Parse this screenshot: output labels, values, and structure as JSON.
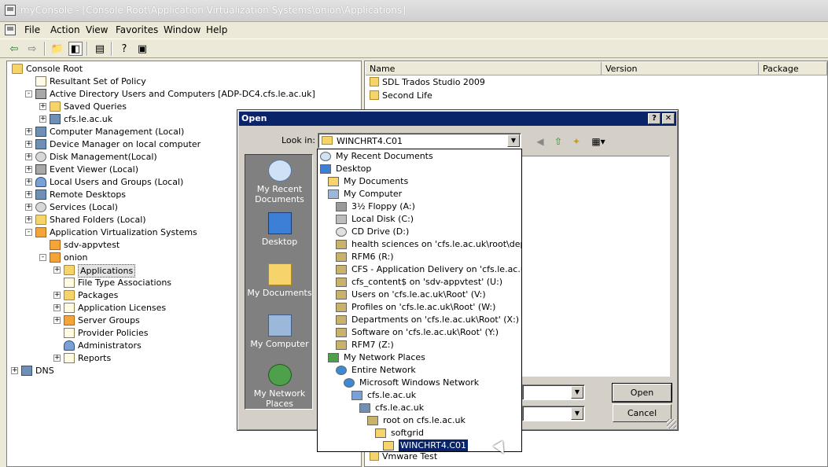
{
  "window": {
    "title": "myConsole - [Console Root\\Application Virtualization Systems\\onion\\Applications]"
  },
  "menu": [
    "File",
    "Action",
    "View",
    "Favorites",
    "Window",
    "Help"
  ],
  "tree": [
    {
      "label": "Console Root",
      "icon": "folder-icon",
      "level": 0,
      "expander": ""
    },
    {
      "label": "Resultant Set of Policy",
      "icon": "policy-icon",
      "level": 1,
      "expander": ""
    },
    {
      "label": "Active Directory Users and Computers [ADP-DC4.cfs.le.ac.uk]",
      "icon": "ad-users-icon",
      "level": 1,
      "expander": "-"
    },
    {
      "label": "Saved Queries",
      "icon": "folder-icon",
      "level": 2,
      "expander": "+"
    },
    {
      "label": "cfs.le.ac.uk",
      "icon": "domain-icon",
      "level": 2,
      "expander": "+"
    },
    {
      "label": "Computer Management (Local)",
      "icon": "computer-icon",
      "level": 1,
      "expander": "+"
    },
    {
      "label": "Device Manager on local computer",
      "icon": "device-icon",
      "level": 1,
      "expander": "+"
    },
    {
      "label": "Disk Management(Local)",
      "icon": "disk-icon",
      "level": 1,
      "expander": "+"
    },
    {
      "label": "Event Viewer (Local)",
      "icon": "event-icon",
      "level": 1,
      "expander": "+"
    },
    {
      "label": "Local Users and Groups (Local)",
      "icon": "users-icon",
      "level": 1,
      "expander": "+"
    },
    {
      "label": "Remote Desktops",
      "icon": "remote-icon",
      "level": 1,
      "expander": "+"
    },
    {
      "label": "Services (Local)",
      "icon": "gear-icon",
      "level": 1,
      "expander": "+"
    },
    {
      "label": "Shared Folders (Local)",
      "icon": "shared-folder-icon",
      "level": 1,
      "expander": "+"
    },
    {
      "label": "Application Virtualization Systems",
      "icon": "appvirt-icon",
      "level": 1,
      "expander": "-"
    },
    {
      "label": "sdv-appvtest",
      "icon": "server-icon",
      "level": 2,
      "expander": ""
    },
    {
      "label": "onion",
      "icon": "server-icon",
      "level": 2,
      "expander": "-"
    },
    {
      "label": "Applications",
      "icon": "folder-icon",
      "level": 3,
      "expander": "+",
      "selected": true
    },
    {
      "label": "File Type Associations",
      "icon": "doc-icon",
      "level": 3,
      "expander": ""
    },
    {
      "label": "Packages",
      "icon": "package-icon",
      "level": 3,
      "expander": "+"
    },
    {
      "label": "Application Licenses",
      "icon": "license-icon",
      "level": 3,
      "expander": "+"
    },
    {
      "label": "Server Groups",
      "icon": "server-group-icon",
      "level": 3,
      "expander": "+"
    },
    {
      "label": "Provider Policies",
      "icon": "doc-icon",
      "level": 3,
      "expander": ""
    },
    {
      "label": "Administrators",
      "icon": "admin-icon",
      "level": 3,
      "expander": ""
    },
    {
      "label": "Reports",
      "icon": "report-icon",
      "level": 3,
      "expander": "+"
    },
    {
      "label": "DNS",
      "icon": "dns-icon",
      "level": 0,
      "expander": "+"
    }
  ],
  "list": {
    "columns": [
      "Name",
      "Version",
      "Package"
    ],
    "rows_top": [
      "SDL Trados Studio 2009",
      "Second Life"
    ],
    "rows_bottom": [
      "Vmware Test"
    ]
  },
  "dialog": {
    "title": "Open",
    "help": "?",
    "close": "✕",
    "look_in_label": "Look in:",
    "look_in_value": "WINCHRT4.C01",
    "places": [
      "My Recent Documents",
      "Desktop",
      "My Documents",
      "My Computer",
      "My Network Places"
    ],
    "open_label": "Open",
    "cancel_label": "Cancel"
  },
  "dropdown": [
    {
      "label": "My Recent Documents",
      "indent": 0,
      "icon": "recent-icon"
    },
    {
      "label": "Desktop",
      "indent": 0,
      "icon": "desktop-icon"
    },
    {
      "label": "My Documents",
      "indent": 1,
      "icon": "folder-icon"
    },
    {
      "label": "My Computer",
      "indent": 1,
      "icon": "computer-icon"
    },
    {
      "label": "3½ Floppy (A:)",
      "indent": 2,
      "icon": "floppy-icon"
    },
    {
      "label": "Local Disk (C:)",
      "indent": 2,
      "icon": "disk-icon"
    },
    {
      "label": "CD Drive (D:)",
      "indent": 2,
      "icon": "cd-icon"
    },
    {
      "label": "health sciences on 'cfs.le.ac.uk\\root\\departm",
      "indent": 2,
      "icon": "network-drive-icon"
    },
    {
      "label": "RFM6 (R:)",
      "indent": 2,
      "icon": "network-drive-icon"
    },
    {
      "label": "CFS - Application Delivery on 'cfs.le.ac.uk\\roo",
      "indent": 2,
      "icon": "network-drive-icon"
    },
    {
      "label": "cfs_content$ on 'sdv-appvtest' (U:)",
      "indent": 2,
      "icon": "network-drive-icon"
    },
    {
      "label": "Users on 'cfs.le.ac.uk\\Root' (V:)",
      "indent": 2,
      "icon": "network-drive-icon"
    },
    {
      "label": "Profiles on 'cfs.le.ac.uk\\Root' (W:)",
      "indent": 2,
      "icon": "network-drive-icon"
    },
    {
      "label": "Departments on 'cfs.le.ac.uk\\Root' (X:)",
      "indent": 2,
      "icon": "network-drive-icon"
    },
    {
      "label": "Software on 'cfs.le.ac.uk\\Root' (Y:)",
      "indent": 2,
      "icon": "network-drive-icon"
    },
    {
      "label": "RFM7 (Z:)",
      "indent": 2,
      "icon": "network-drive-icon"
    },
    {
      "label": "My Network Places",
      "indent": 1,
      "icon": "network-places-icon"
    },
    {
      "label": "Entire Network",
      "indent": 2,
      "icon": "globe-icon"
    },
    {
      "label": "Microsoft Windows Network",
      "indent": 3,
      "icon": "globe-icon"
    },
    {
      "label": "cfs.le.ac.uk",
      "indent": 4,
      "icon": "domain-icon"
    },
    {
      "label": "cfs.le.ac.uk",
      "indent": 5,
      "icon": "server-icon"
    },
    {
      "label": "root on cfs.le.ac.uk",
      "indent": 6,
      "icon": "network-drive-icon"
    },
    {
      "label": "softgrid",
      "indent": 7,
      "icon": "folder-icon"
    },
    {
      "label": "WINCHRT4.C01",
      "indent": 8,
      "icon": "open-folder-icon",
      "highlighted": true
    }
  ]
}
